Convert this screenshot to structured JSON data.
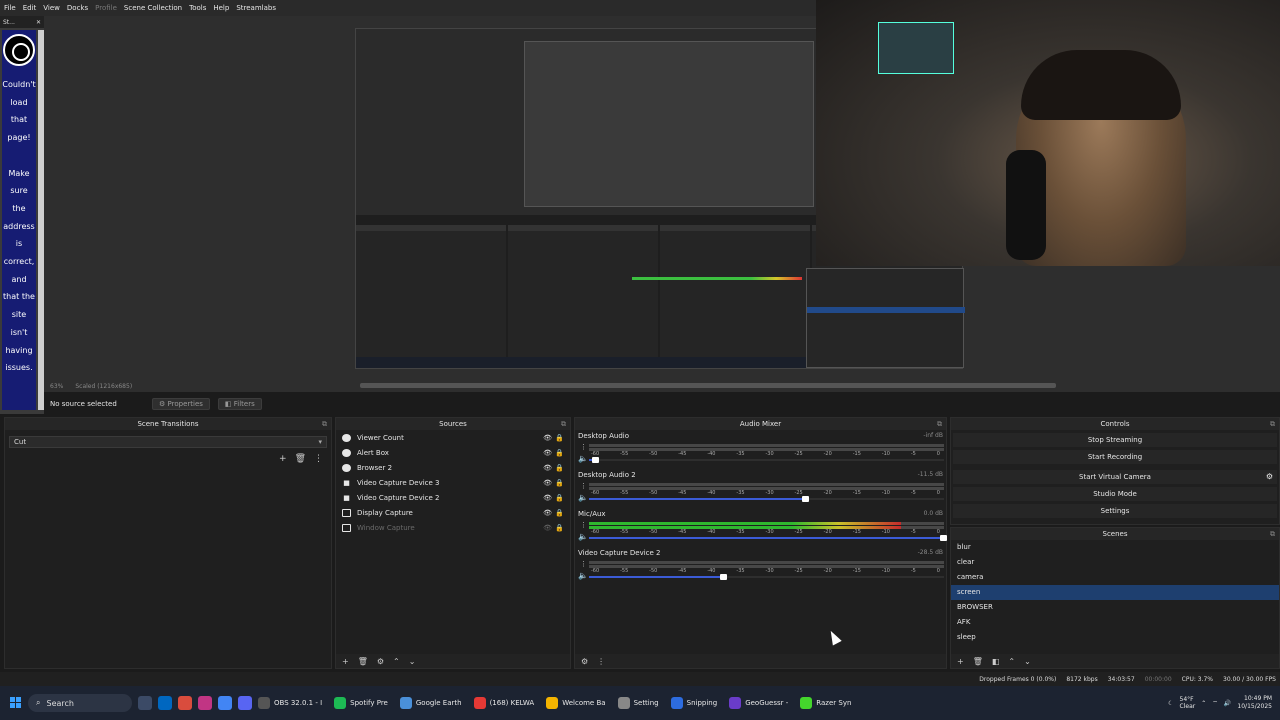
{
  "menu": {
    "items": [
      "File",
      "Edit",
      "View",
      "Docks",
      "Profile",
      "Scene Collection",
      "Tools",
      "Help",
      "Streamlabs"
    ]
  },
  "browser_dock": {
    "title": "St...",
    "message_lines": [
      "Couldn't",
      "load",
      "that",
      "page!",
      "",
      "Make",
      "sure",
      "the",
      "address",
      "is",
      "correct,",
      "and",
      "that the",
      "site",
      "isn't",
      "having",
      "issues."
    ]
  },
  "canvas": {
    "zoom": "63%",
    "scale": "Scaled (1216x685)"
  },
  "properties_bar": {
    "no_source": "No source selected",
    "properties": "Properties",
    "filters": "Filters"
  },
  "scene_transitions": {
    "title": "Scene Transitions",
    "selected": "Cut"
  },
  "sources": {
    "title": "Sources",
    "items": [
      {
        "label": "Viewer Count",
        "icon": "globe-icon"
      },
      {
        "label": "Alert Box",
        "icon": "globe-icon"
      },
      {
        "label": "Browser 2",
        "icon": "globe-icon"
      },
      {
        "label": "Video Capture Device 3",
        "icon": "camera-icon"
      },
      {
        "label": "Video Capture Device 2",
        "icon": "camera-icon"
      },
      {
        "label": "Display Capture",
        "icon": "monitor-icon"
      },
      {
        "label": "Window Capture",
        "icon": "window-icon"
      }
    ]
  },
  "audio_mixer": {
    "title": "Audio Mixer",
    "ticks": [
      "-60",
      "-55",
      "-50",
      "-45",
      "-40",
      "-35",
      "-30",
      "-25",
      "-20",
      "-15",
      "-10",
      "-5",
      "0"
    ],
    "channels": [
      {
        "name": "Desktop Audio",
        "db": "-inf dB",
        "level": 0.0,
        "volume": 0.02,
        "muted": true
      },
      {
        "name": "Desktop Audio 2",
        "db": "-11.5 dB",
        "level": 0.0,
        "volume": 0.61,
        "muted": true
      },
      {
        "name": "Mic/Aux",
        "db": "0.0 dB",
        "level": 0.88,
        "volume": 1.0,
        "muted": false
      },
      {
        "name": "Video Capture Device 2",
        "db": "-28.5 dB",
        "level": 0.0,
        "volume": 0.38,
        "muted": true
      }
    ]
  },
  "controls": {
    "title": "Controls",
    "stop_streaming": "Stop Streaming",
    "start_recording": "Start Recording",
    "start_virtual_camera": "Start Virtual Camera",
    "studio_mode": "Studio Mode",
    "settings": "Settings"
  },
  "scenes": {
    "title": "Scenes",
    "items": [
      "blur",
      "clear",
      "camera",
      "screen",
      "BROWSER",
      "AFK",
      "sleep"
    ],
    "active": "screen"
  },
  "status": {
    "dropped_frames": "Dropped Frames 0 (0.0%)",
    "bitrate": "8172 kbps",
    "live_time": "34:03:57",
    "rec_time": "00:00:00",
    "cpu": "CPU: 3.7%",
    "fps": "30.00 / 30.00 FPS"
  },
  "taskbar": {
    "search_placeholder": "Search",
    "apps": [
      {
        "label": "OBS 32.0.1 - I",
        "color": "#555555"
      },
      {
        "label": "Spotify Pre",
        "color": "#1db954"
      },
      {
        "label": "Google Earth",
        "color": "#4a90d9"
      },
      {
        "label": "(168) KELWA",
        "color": "#e53935"
      },
      {
        "label": "Welcome Ba",
        "color": "#f4b400"
      },
      {
        "label": "Setting",
        "color": "#888888"
      },
      {
        "label": "Snipping",
        "color": "#2d6cdf"
      },
      {
        "label": "GeoGuessr -",
        "color": "#6a3cc9"
      },
      {
        "label": "Razer Syn",
        "color": "#44d62c"
      }
    ],
    "weather_temp": "54°F",
    "weather_desc": "Clear",
    "time": "10:49 PM",
    "date": "10/15/2025"
  }
}
